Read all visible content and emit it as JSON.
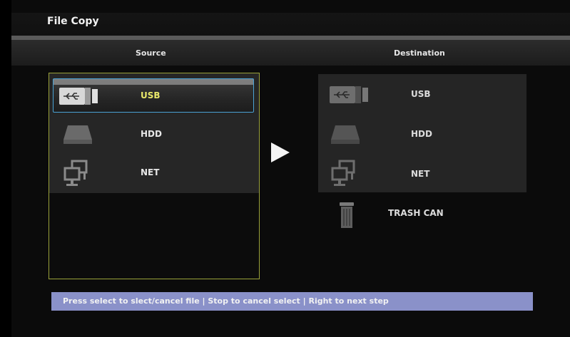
{
  "header": {
    "title": "File Copy"
  },
  "columns": {
    "source": "Source",
    "destination": "Destination"
  },
  "source": {
    "items": [
      {
        "label": "USB",
        "icon": "usb-icon",
        "selected": true
      },
      {
        "label": "HDD",
        "icon": "hdd-icon",
        "selected": false
      },
      {
        "label": "NET",
        "icon": "network-icon",
        "selected": false
      }
    ]
  },
  "destination": {
    "items": [
      {
        "label": "USB",
        "icon": "usb-icon"
      },
      {
        "label": "HDD",
        "icon": "hdd-icon"
      },
      {
        "label": "NET",
        "icon": "network-icon"
      }
    ],
    "trash_label": "TRASH CAN"
  },
  "status": {
    "hint": "Press select to slect/cancel file | Stop to cancel select | Right to next step"
  },
  "colors": {
    "selection_text": "#e9e86a",
    "panel_border": "#9aa23a",
    "status_bar": "#8a91c9",
    "focus_border": "#4aa3d6"
  }
}
